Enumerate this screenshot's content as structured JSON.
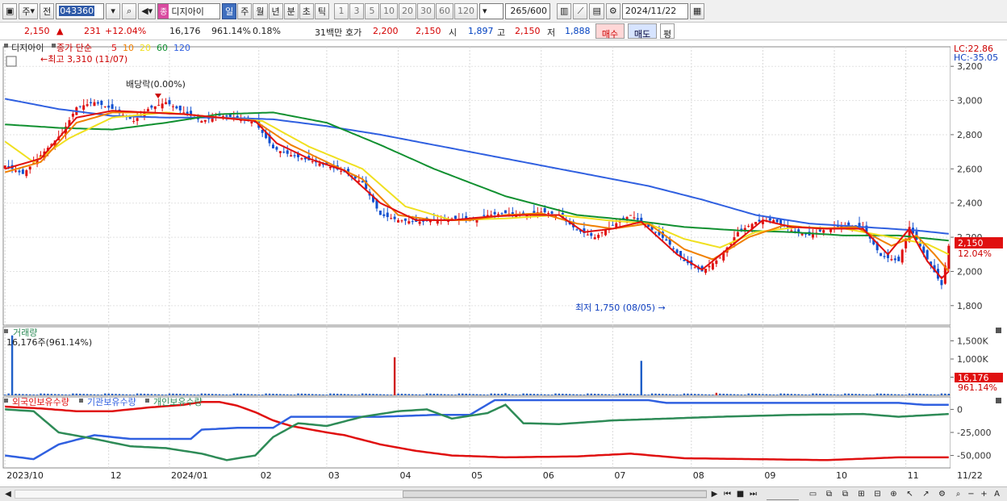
{
  "toolbar": {
    "period_mode": "주",
    "prev_label": "전",
    "stock_code": "043360",
    "stock_tag": "종",
    "stock_name": "디지아이",
    "periods": [
      "일",
      "주",
      "월",
      "년",
      "분",
      "초",
      "틱"
    ],
    "selected_period": "일",
    "intervals": [
      "1",
      "3",
      "5",
      "10",
      "20",
      "30",
      "60",
      "120"
    ],
    "bar_count": "265",
    "bar_max": "/600",
    "date": "2024/11/22"
  },
  "info": {
    "price": "2,150",
    "change": "231",
    "change_pct": "+12.04%",
    "volume": "16,176",
    "volume_pct": "961.14%",
    "turnover_pct": "0.18%",
    "amount": "31백만",
    "quote_label": "호가",
    "ask": "2,200",
    "bid": "2,150",
    "open_label": "시",
    "open": "1,897",
    "high_label": "고",
    "high": "2,150",
    "low_label": "저",
    "low": "1,888",
    "buy_label": "매수",
    "sell_label": "매도",
    "avg_label": "평"
  },
  "panels": {
    "price_legend_name": "디지아이",
    "price_legend_ma": "종가 단순",
    "ma_periods": [
      "5",
      "10",
      "20",
      "60",
      "120"
    ],
    "ma_colors": [
      "#e01010",
      "#f08000",
      "#f0e020",
      "#109030",
      "#3060e0"
    ],
    "lc_label": "LC:22.86",
    "hc_label": "HC:-35.05",
    "high_annotation": "최고 3,310 (11/07)",
    "low_annotation": "최저 1,750 (08/05)",
    "dividend_annotation": "배당락(0.00%)",
    "price_tag": "2,150",
    "price_pct_tag": "12.04%",
    "volume_title": "거래량",
    "volume_subtitle": "16,176주(961.14%)",
    "volume_tag": "16,176",
    "volume_pct_tag": "961.14%",
    "holdings_series": [
      "외국인보유수량",
      "기관보유수량",
      "개인보유수량"
    ],
    "holdings_colors": [
      "#e01010",
      "#3060e0",
      "#2e8b57"
    ],
    "x_end_label": "11/22"
  },
  "chart_data": [
    {
      "type": "candlestick",
      "title": "디지아이",
      "x_labels": [
        "2023/10",
        "12",
        "2024/01",
        "02",
        "03",
        "04",
        "05",
        "06",
        "07",
        "08",
        "09",
        "10",
        "11"
      ],
      "ylim": [
        1700,
        3300
      ],
      "y_ticks": [
        "3,200",
        "3,000",
        "2,800",
        "2,600",
        "2,400",
        "2,200",
        "2,000",
        "1,800"
      ],
      "close_path": [
        [
          0,
          2620
        ],
        [
          5,
          2570
        ],
        [
          10,
          2680
        ],
        [
          16,
          2810
        ],
        [
          20,
          2960
        ],
        [
          25,
          2990
        ],
        [
          30,
          2950
        ],
        [
          36,
          2880
        ],
        [
          40,
          2950
        ],
        [
          45,
          2990
        ],
        [
          50,
          2930
        ],
        [
          55,
          2880
        ],
        [
          60,
          2910
        ],
        [
          65,
          2900
        ],
        [
          70,
          2870
        ],
        [
          75,
          2720
        ],
        [
          80,
          2680
        ],
        [
          85,
          2650
        ],
        [
          90,
          2620
        ],
        [
          95,
          2580
        ],
        [
          100,
          2520
        ],
        [
          105,
          2330
        ],
        [
          110,
          2300
        ],
        [
          115,
          2290
        ],
        [
          120,
          2300
        ],
        [
          125,
          2310
        ],
        [
          130,
          2300
        ],
        [
          135,
          2330
        ],
        [
          140,
          2340
        ],
        [
          145,
          2330
        ],
        [
          150,
          2350
        ],
        [
          155,
          2330
        ],
        [
          160,
          2240
        ],
        [
          165,
          2200
        ],
        [
          170,
          2270
        ],
        [
          175,
          2330
        ],
        [
          180,
          2260
        ],
        [
          185,
          2180
        ],
        [
          190,
          2060
        ],
        [
          195,
          2000
        ],
        [
          200,
          2080
        ],
        [
          205,
          2230
        ],
        [
          210,
          2290
        ],
        [
          215,
          2300
        ],
        [
          220,
          2240
        ],
        [
          225,
          2210
        ],
        [
          230,
          2250
        ],
        [
          235,
          2270
        ],
        [
          240,
          2260
        ],
        [
          245,
          2090
        ],
        [
          250,
          2060
        ],
        [
          253,
          2260
        ],
        [
          258,
          2070
        ],
        [
          262,
          1920
        ],
        [
          264,
          2150
        ]
      ],
      "ma_paths": {
        "5": [
          [
            0,
            2600
          ],
          [
            10,
            2660
          ],
          [
            20,
            2900
          ],
          [
            30,
            2940
          ],
          [
            40,
            2930
          ],
          [
            50,
            2920
          ],
          [
            60,
            2900
          ],
          [
            70,
            2880
          ],
          [
            76,
            2750
          ],
          [
            85,
            2660
          ],
          [
            95,
            2590
          ],
          [
            105,
            2400
          ],
          [
            115,
            2300
          ],
          [
            125,
            2300
          ],
          [
            135,
            2320
          ],
          [
            145,
            2330
          ],
          [
            155,
            2330
          ],
          [
            162,
            2230
          ],
          [
            170,
            2250
          ],
          [
            178,
            2290
          ],
          [
            188,
            2100
          ],
          [
            195,
            2010
          ],
          [
            205,
            2180
          ],
          [
            212,
            2300
          ],
          [
            220,
            2260
          ],
          [
            230,
            2250
          ],
          [
            240,
            2250
          ],
          [
            247,
            2100
          ],
          [
            253,
            2250
          ],
          [
            258,
            2060
          ],
          [
            262,
            1960
          ],
          [
            264,
            2000
          ]
        ],
        "10": [
          [
            0,
            2580
          ],
          [
            10,
            2640
          ],
          [
            20,
            2870
          ],
          [
            30,
            2930
          ],
          [
            40,
            2930
          ],
          [
            50,
            2920
          ],
          [
            60,
            2900
          ],
          [
            70,
            2880
          ],
          [
            80,
            2740
          ],
          [
            90,
            2640
          ],
          [
            100,
            2540
          ],
          [
            110,
            2330
          ],
          [
            120,
            2300
          ],
          [
            130,
            2300
          ],
          [
            140,
            2330
          ],
          [
            150,
            2340
          ],
          [
            160,
            2280
          ],
          [
            170,
            2250
          ],
          [
            180,
            2280
          ],
          [
            190,
            2130
          ],
          [
            198,
            2070
          ],
          [
            208,
            2200
          ],
          [
            218,
            2270
          ],
          [
            228,
            2250
          ],
          [
            238,
            2260
          ],
          [
            248,
            2150
          ],
          [
            255,
            2210
          ],
          [
            260,
            2100
          ],
          [
            264,
            2000
          ]
        ],
        "20": [
          [
            0,
            2760
          ],
          [
            8,
            2640
          ],
          [
            18,
            2780
          ],
          [
            30,
            2900
          ],
          [
            45,
            2930
          ],
          [
            60,
            2900
          ],
          [
            72,
            2880
          ],
          [
            85,
            2730
          ],
          [
            100,
            2600
          ],
          [
            112,
            2380
          ],
          [
            125,
            2300
          ],
          [
            140,
            2310
          ],
          [
            155,
            2330
          ],
          [
            168,
            2300
          ],
          [
            180,
            2280
          ],
          [
            190,
            2190
          ],
          [
            200,
            2140
          ],
          [
            210,
            2230
          ],
          [
            222,
            2260
          ],
          [
            235,
            2250
          ],
          [
            248,
            2200
          ],
          [
            258,
            2160
          ],
          [
            264,
            2100
          ]
        ],
        "60": [
          [
            0,
            2860
          ],
          [
            15,
            2840
          ],
          [
            30,
            2830
          ],
          [
            45,
            2870
          ],
          [
            60,
            2920
          ],
          [
            75,
            2930
          ],
          [
            90,
            2870
          ],
          [
            105,
            2740
          ],
          [
            120,
            2600
          ],
          [
            140,
            2440
          ],
          [
            160,
            2330
          ],
          [
            175,
            2300
          ],
          [
            190,
            2260
          ],
          [
            205,
            2240
          ],
          [
            220,
            2230
          ],
          [
            235,
            2210
          ],
          [
            250,
            2210
          ],
          [
            264,
            2180
          ]
        ],
        "120": [
          [
            0,
            3010
          ],
          [
            15,
            2950
          ],
          [
            30,
            2910
          ],
          [
            45,
            2900
          ],
          [
            60,
            2900
          ],
          [
            75,
            2890
          ],
          [
            90,
            2850
          ],
          [
            105,
            2800
          ],
          [
            120,
            2740
          ],
          [
            135,
            2680
          ],
          [
            150,
            2620
          ],
          [
            165,
            2560
          ],
          [
            180,
            2500
          ],
          [
            195,
            2420
          ],
          [
            210,
            2330
          ],
          [
            225,
            2280
          ],
          [
            240,
            2260
          ],
          [
            255,
            2240
          ],
          [
            264,
            2220
          ]
        ]
      }
    },
    {
      "type": "bar",
      "title": "거래량",
      "y_ticks": [
        "1,500K",
        "1,000K",
        "500,000"
      ],
      "ylim": [
        0,
        1800000
      ],
      "spikes": [
        [
          2,
          1650000
        ],
        [
          109,
          1050000
        ],
        [
          140,
          60000
        ],
        [
          178,
          950000
        ],
        [
          199,
          70000
        ],
        [
          220,
          40000
        ]
      ]
    },
    {
      "type": "line",
      "title": "보유수량",
      "y_ticks": [
        "0",
        "-25,000",
        "-50,000"
      ],
      "ylim": [
        -60000,
        10000
      ],
      "series": [
        {
          "name": "외국인보유수량",
          "values": [
            [
              0,
              3000
            ],
            [
              10,
              1000
            ],
            [
              20,
              -2000
            ],
            [
              30,
              -2000
            ],
            [
              40,
              2000
            ],
            [
              50,
              5000
            ],
            [
              55,
              8000
            ],
            [
              60,
              8000
            ],
            [
              65,
              4000
            ],
            [
              70,
              -3000
            ],
            [
              75,
              -12000
            ],
            [
              80,
              -18000
            ],
            [
              90,
              -25000
            ],
            [
              95,
              -28000
            ],
            [
              105,
              -38000
            ],
            [
              115,
              -45000
            ],
            [
              125,
              -50000
            ],
            [
              140,
              -52000
            ],
            [
              160,
              -51000
            ],
            [
              175,
              -48000
            ],
            [
              190,
              -53000
            ],
            [
              210,
              -54000
            ],
            [
              230,
              -55000
            ],
            [
              250,
              -52000
            ],
            [
              264,
              -52000
            ]
          ]
        },
        {
          "name": "기관보유수량",
          "values": [
            [
              0,
              -50000
            ],
            [
              8,
              -54000
            ],
            [
              15,
              -38000
            ],
            [
              25,
              -28000
            ],
            [
              35,
              -32000
            ],
            [
              45,
              -32000
            ],
            [
              52,
              -32000
            ],
            [
              55,
              -22000
            ],
            [
              65,
              -20000
            ],
            [
              75,
              -20000
            ],
            [
              80,
              -8000
            ],
            [
              95,
              -8000
            ],
            [
              105,
              -8000
            ],
            [
              120,
              -6000
            ],
            [
              130,
              -6000
            ],
            [
              137,
              10000
            ],
            [
              150,
              10000
            ],
            [
              180,
              10000
            ],
            [
              185,
              7000
            ],
            [
              250,
              7000
            ],
            [
              257,
              5000
            ],
            [
              264,
              5000
            ]
          ]
        },
        {
          "name": "개인보유수량",
          "values": [
            [
              0,
              0
            ],
            [
              8,
              -2000
            ],
            [
              15,
              -25000
            ],
            [
              25,
              -32000
            ],
            [
              35,
              -40000
            ],
            [
              45,
              -42000
            ],
            [
              55,
              -48000
            ],
            [
              62,
              -55000
            ],
            [
              70,
              -50000
            ],
            [
              75,
              -30000
            ],
            [
              82,
              -15000
            ],
            [
              90,
              -18000
            ],
            [
              100,
              -8000
            ],
            [
              110,
              -2000
            ],
            [
              118,
              0
            ],
            [
              125,
              -10000
            ],
            [
              135,
              -4000
            ],
            [
              140,
              5000
            ],
            [
              145,
              -15000
            ],
            [
              155,
              -16000
            ],
            [
              170,
              -12000
            ],
            [
              185,
              -10000
            ],
            [
              200,
              -8000
            ],
            [
              220,
              -6000
            ],
            [
              240,
              -5000
            ],
            [
              250,
              -8000
            ],
            [
              264,
              -5000
            ]
          ]
        }
      ]
    }
  ]
}
